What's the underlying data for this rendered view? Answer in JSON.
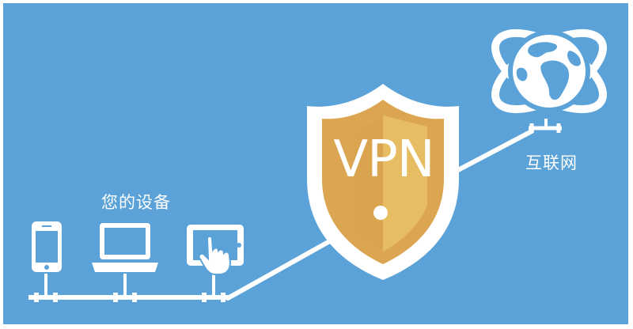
{
  "labels": {
    "devices": "您的设备",
    "internet": "互联网",
    "vpn": "VPN"
  },
  "colors": {
    "background": "#5aa2d8",
    "foreground": "#ffffff",
    "shield_outer": "#ffffff",
    "shield_fill": "#dba552",
    "shield_highlight": "#e9c166"
  },
  "icons": [
    "smartphone-icon",
    "laptop-icon",
    "tablet-touch-icon",
    "shield-icon",
    "globe-icon"
  ]
}
